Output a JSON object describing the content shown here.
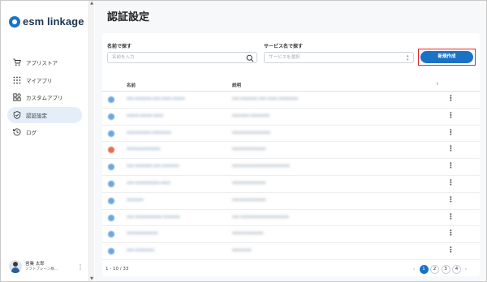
{
  "app": {
    "logo_text": "esm linkage"
  },
  "sidebar": {
    "items": [
      {
        "label": "アプリストア",
        "icon": "cart-icon",
        "active": false
      },
      {
        "label": "マイアプリ",
        "icon": "grid-icon",
        "active": false
      },
      {
        "label": "カスタムアプリ",
        "icon": "blocks-icon",
        "active": false
      },
      {
        "label": "認証設定",
        "icon": "shield-icon",
        "active": true
      },
      {
        "label": "ログ",
        "icon": "history-icon",
        "active": false
      }
    ],
    "user": {
      "name": "営業 太郎",
      "org": "ソフトブレーン株..."
    }
  },
  "page": {
    "title": "認証設定"
  },
  "search": {
    "name_label": "名前で探す",
    "name_placeholder": "名前を入力",
    "service_label": "サービス名で探す",
    "service_placeholder": "サービスを選択",
    "new_button": "新規作成"
  },
  "table": {
    "headers": {
      "name": "名前",
      "description": "説明"
    },
    "rows": [
      {
        "icon_color": "#6fa6dc",
        "name": "sso-xxxxxxx-xxx-xxxx-xxxxx",
        "desc": "xxx-xxxxxxx-xxx-xxxx-xxxxxxxx"
      },
      {
        "icon_color": "#6fa6dc",
        "name": "xxxxx-xxxxx-xxxx",
        "desc": "xxxxxxx-xxxxxxxx"
      },
      {
        "icon_color": "#6fa6dc",
        "name": "xxxxxxxxxx-xxxxxxxx",
        "desc": "xxxxxxxxxxxxxxxx"
      },
      {
        "icon_color": "#e56b5c",
        "name": "xxxxxxxxxxxxxx",
        "desc": "xxxxxxxxxxxxxx"
      },
      {
        "icon_color": "#6fa6dc",
        "name": "xxx-xxxxxxx-xxx-xxxxxxx",
        "desc": "xxxxxxxxxxxxxxxxxxxxxxxx"
      },
      {
        "icon_color": "#6fa6dc",
        "name": "xxx-xxxxxxxxxx-xxxx",
        "desc": "xxxxxxxxxxxxxx"
      },
      {
        "icon_color": "#6fa6dc",
        "name": "xxxxxxx",
        "desc": "xxxxxxxxxxxxxx"
      },
      {
        "icon_color": "#6fa6dc",
        "name": "xxx-xxxxxxxxxxx-xxxxxxx",
        "desc": "xxx-xxxxxxxxxxxxxxxxxxxx"
      },
      {
        "icon_color": "#6fa6dc",
        "name": "xxxxxxxxxxxxx",
        "desc": "xxxxxxxxxxxxx"
      },
      {
        "icon_color": "#6fa6dc",
        "name": "xxx-xxxxxxxx",
        "desc": "xxxxxxxx"
      }
    ]
  },
  "pagination": {
    "range": "1 - 10 / 33",
    "pages": [
      "1",
      "2",
      "3",
      "4"
    ],
    "current": "1"
  },
  "colors": {
    "accent": "#1a72c4",
    "highlight": "#e0262f"
  }
}
